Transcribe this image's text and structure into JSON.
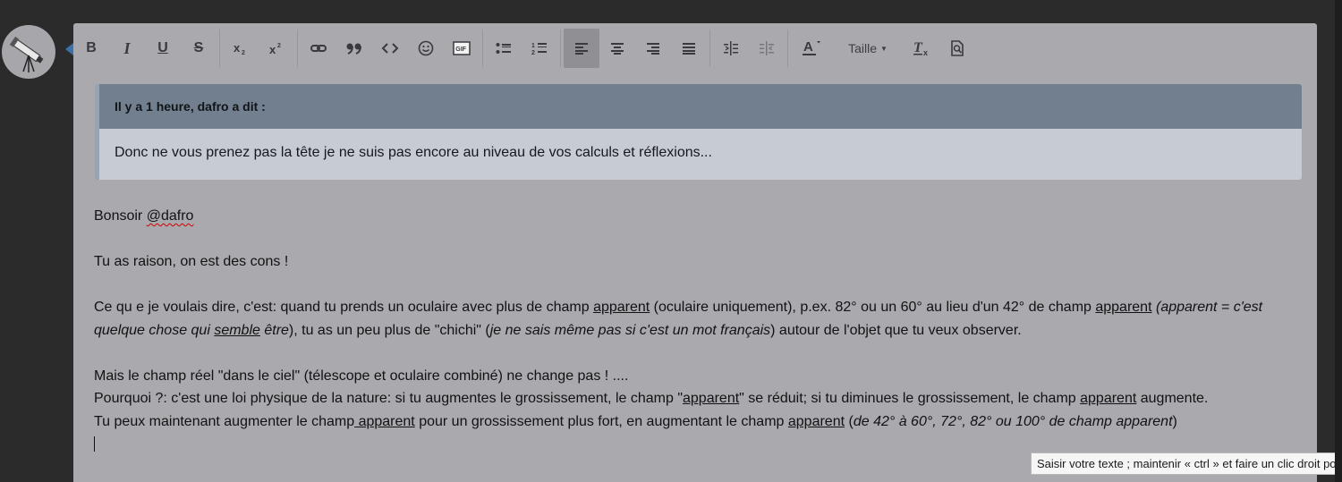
{
  "toolbar": {
    "bold": "B",
    "italic": "I",
    "underline": "U",
    "strike": "S",
    "font_size_label": "Taille"
  },
  "quote": {
    "header": "Il y a 1 heure, dafro a dit :",
    "body": "Donc ne vous prenez pas la tête je ne suis pas encore au niveau de vos calculs et réflexions..."
  },
  "post": {
    "greeting_prefix": "Bonsoir ",
    "mention": "@dafro",
    "line2": "Tu as raison, on est des cons !",
    "p3": {
      "a": "Ce qu e je voulais dire, c'est:  quand tu prends un oculaire avec plus de champ ",
      "b": "apparent",
      "c": " (oculaire uniquement), p.ex. 82° ou un 60° au lieu d'un 42° de champ ",
      "d": "apparent",
      "e": " ",
      "f": "(apparent = c'est quelque chose qui ",
      "g": "semble",
      "h": " être",
      "i": "), tu as un peu plus de \"chichi\" (",
      "j": "je ne sais même pas si c'est un mot français",
      "k": ") autour de l'objet que tu veux observer."
    },
    "p4": "Mais le champ réel \"dans le ciel\" (télescope et oculaire combiné) ne change pas ! ....",
    "p5": {
      "a": "Pourquoi ?: c'est une loi physique de la nature: si tu augmentes le grossissement, le champ \"",
      "b": "apparent",
      "c": "\" se réduit; si tu diminues le grossissement, le champ ",
      "d": "apparent",
      "e": " augmente."
    },
    "p6": {
      "a": "Tu peux maintenant augmenter le champ",
      "b": " apparent",
      "c": " pour un grossissement plus fort, en augmentant le champ ",
      "d": "apparent",
      "e": " (",
      "f": "de 42° à 60°, 72°, 82° ou 100° de champ apparent",
      "g": ")"
    }
  },
  "tooltip": "Saisir votre texte ; maintenir « ctrl » et faire un clic droit pour",
  "icons": {
    "subscript": "subscript-icon",
    "superscript": "superscript-icon",
    "link": "link-icon",
    "quote": "quote-icon",
    "code": "code-icon",
    "emoji": "emoji-icon",
    "gif": "gif-icon",
    "bullets": "bulleted-list-icon",
    "numbers": "numbered-list-icon",
    "align_left": "align-left-icon",
    "align_center": "align-center-icon",
    "align_right": "align-right-icon",
    "justify": "justify-icon",
    "indent": "indent-icon",
    "outdent": "outdent-icon",
    "text_color": "text-color-icon",
    "clear_format": "clear-format-icon",
    "preview": "preview-icon"
  },
  "colors": {
    "editor_bg": "#a9a9ae",
    "quote_header_bg": "#727f8e",
    "quote_body_bg": "#c7ccd4",
    "active_button": "#8f8f94",
    "page_bg": "#2b2b2b"
  }
}
